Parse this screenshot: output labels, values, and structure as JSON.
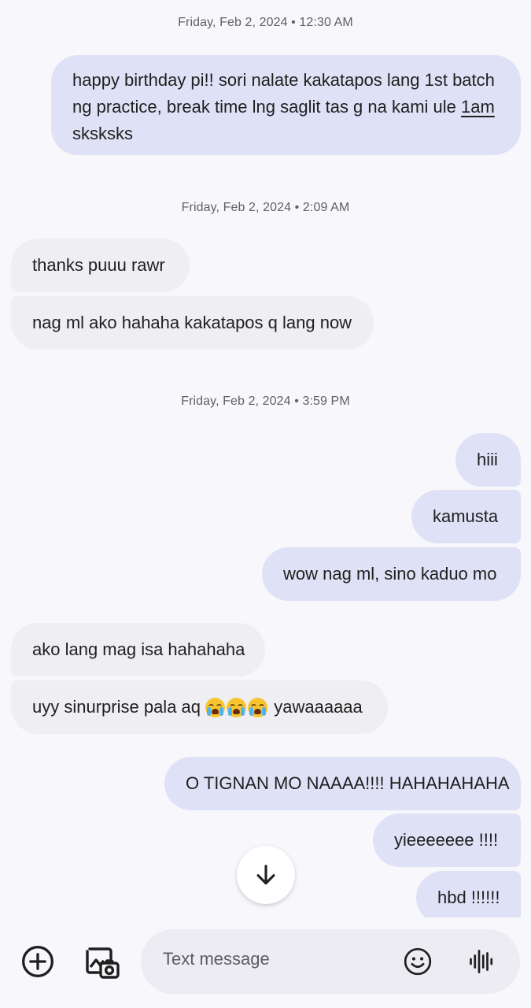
{
  "timestamps": [
    "Friday, Feb 2, 2024 • 12:30 AM",
    "Friday, Feb 2, 2024 • 2:09 AM",
    "Friday, Feb 2, 2024 • 3:59 PM"
  ],
  "messages": [
    {
      "direction": "outgoing",
      "text_parts": [
        "happy birthday pi!! sori nalate kakatapos lang 1st batch ng practice, break time lng saglit tas g na kami ule ",
        "1am",
        " sksksks"
      ]
    },
    {
      "direction": "incoming",
      "text": "thanks puuu rawr"
    },
    {
      "direction": "incoming",
      "text": "nag ml ako hahaha kakatapos q lang now"
    },
    {
      "direction": "outgoing",
      "text": "hiii"
    },
    {
      "direction": "outgoing",
      "text": "kamusta"
    },
    {
      "direction": "outgoing",
      "text": "wow nag ml, sino kaduo mo"
    },
    {
      "direction": "incoming",
      "text": "ako lang mag isa hahahaha"
    },
    {
      "direction": "incoming",
      "text_before": "uyy sinurprise pala aq ",
      "emoji": "loudly-crying-face",
      "emoji_count": 3,
      "text_after": " yawaaaaaa"
    },
    {
      "direction": "outgoing",
      "text": "O TIGNAN MO NAAAA!!!! HAHAHAHAHA"
    },
    {
      "direction": "outgoing",
      "text": "yieeeeeee !!!!"
    },
    {
      "direction": "outgoing",
      "text": "hbd !!!!!!"
    }
  ],
  "composer": {
    "placeholder": "Text message",
    "icons": [
      "add-icon",
      "gallery-icon",
      "emoji-icon",
      "voice-icon"
    ]
  },
  "scroll_button": {
    "icon": "arrow-down-icon"
  },
  "colors": {
    "background": "#f8f8fc",
    "outgoing_bubble": "#dfe1f6",
    "incoming_bubble": "#efeff3",
    "timestamp_text": "#5f6066"
  }
}
